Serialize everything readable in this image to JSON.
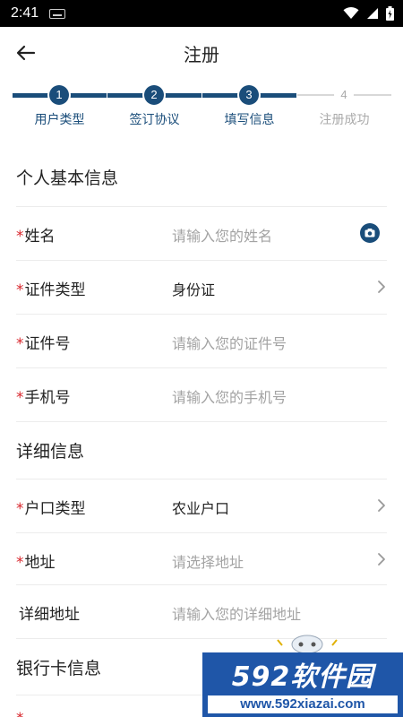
{
  "status_bar": {
    "time": "2:41"
  },
  "header": {
    "title": "注册"
  },
  "stepper": {
    "steps": [
      {
        "number": "1",
        "label": "用户类型"
      },
      {
        "number": "2",
        "label": "签订协议"
      },
      {
        "number": "3",
        "label": "填写信息"
      },
      {
        "number": "4",
        "label": "注册成功"
      }
    ],
    "current_step": 3
  },
  "form": {
    "section_basic": "个人基本信息",
    "name": {
      "label": "姓名",
      "placeholder": "请输入您的姓名"
    },
    "id_type": {
      "label": "证件类型",
      "value": "身份证"
    },
    "id_number": {
      "label": "证件号",
      "placeholder": "请输入您的证件号"
    },
    "phone": {
      "label": "手机号",
      "placeholder": "请输入您的手机号"
    },
    "section_detail": "详细信息",
    "household_type": {
      "label": "户口类型",
      "value": "农业户口"
    },
    "address": {
      "label": "地址",
      "placeholder": "请选择地址"
    },
    "detail_address": {
      "label": "详细地址",
      "placeholder": "请输入您的详细地址"
    },
    "section_bank": "银行卡信息",
    "required_mark": "*"
  },
  "watermark": {
    "brand": "592软件园",
    "url": "www.592xiazai.com"
  },
  "colors": {
    "primary": "#1a4d7a",
    "required": "#d8262c",
    "placeholder": "#a3a3a3"
  },
  "icons": [
    "back-arrow-icon",
    "camera-icon",
    "chevron-right-icon",
    "wifi-icon",
    "signal-icon",
    "battery-icon",
    "keyboard-icon"
  ]
}
